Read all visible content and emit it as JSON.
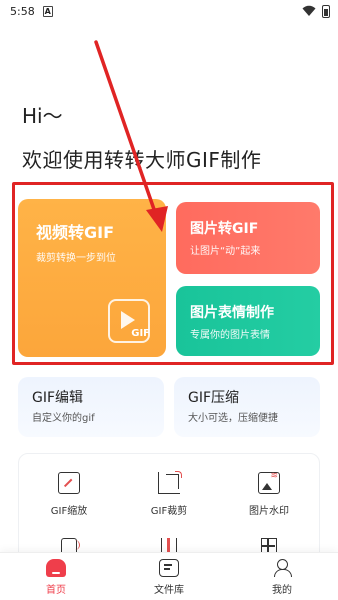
{
  "status_bar": {
    "time": "5:58",
    "notification_badge": "A"
  },
  "header": {
    "greeting": "Hi～",
    "welcome": "欢迎使用转转大师GIF制作"
  },
  "cards": {
    "video_to_gif": {
      "title": "视频转GIF",
      "subtitle": "裁剪转换一步到位",
      "badge": "GIF",
      "color": "#fca63b"
    },
    "image_to_gif": {
      "title": "图片转GIF",
      "subtitle": "让图片“动”起来",
      "color": "#ff6b5e"
    },
    "emoji_maker": {
      "title": "图片表情制作",
      "subtitle": "专属你的图片表情",
      "color": "#19c49a"
    }
  },
  "tools": {
    "gif_edit": {
      "title": "GIF编辑",
      "subtitle": "自定义你的gif"
    },
    "gif_compress": {
      "title": "GIF压缩",
      "subtitle": "大小可选，压缩便捷"
    }
  },
  "grid": {
    "items": [
      {
        "label": "GIF缩放",
        "icon": "resize-icon"
      },
      {
        "label": "GIF裁剪",
        "icon": "crop-icon"
      },
      {
        "label": "图片水印",
        "icon": "watermark-icon"
      }
    ]
  },
  "nav": {
    "items": [
      {
        "label": "首页",
        "icon": "home-icon",
        "active": true
      },
      {
        "label": "文件库",
        "icon": "file-library-icon",
        "active": false
      },
      {
        "label": "我的",
        "icon": "profile-icon",
        "active": false
      }
    ]
  },
  "colors": {
    "accent_red": "#ef3e4b",
    "annotation_red": "#e02424"
  }
}
